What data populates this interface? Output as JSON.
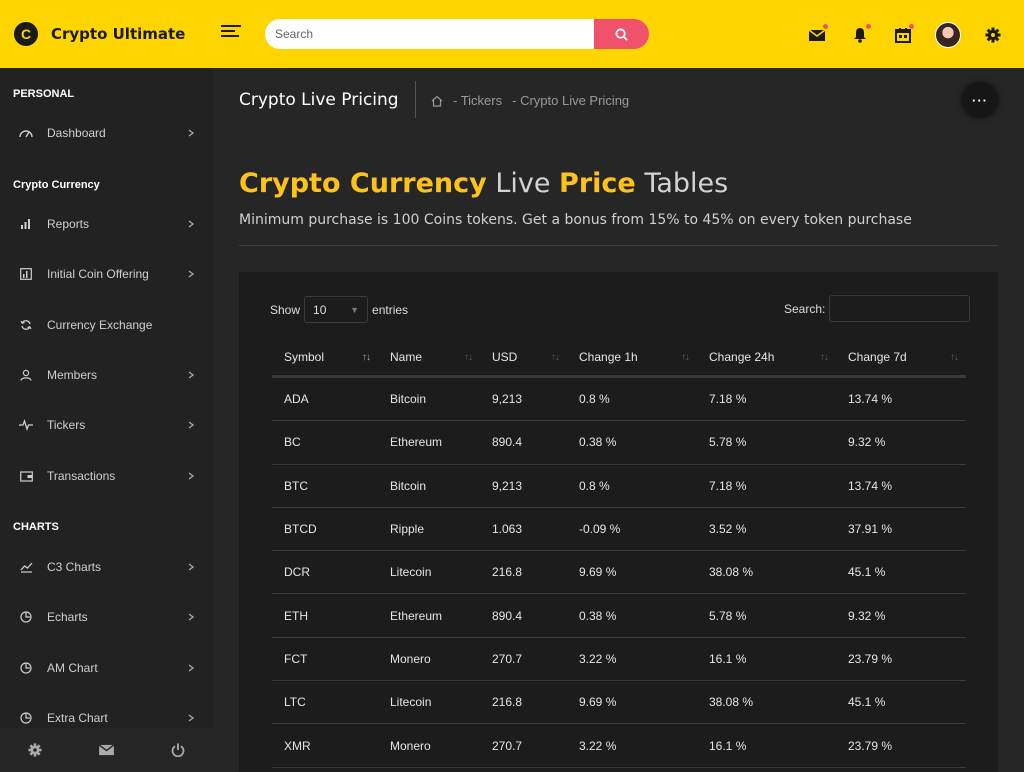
{
  "brand": {
    "name": "Crypto Ultimate",
    "logo_letter": "C"
  },
  "search": {
    "placeholder": "Search"
  },
  "sidebar": {
    "sections": [
      {
        "title": "PERSONAL"
      },
      {
        "title": "Crypto Currency"
      },
      {
        "title": "CHARTS"
      }
    ],
    "items": [
      {
        "label": "Dashboard",
        "icon": "speedometer-icon"
      },
      {
        "label": "Reports",
        "icon": "bar-chart-icon"
      },
      {
        "label": "Initial Coin Offering",
        "icon": "ico-chart-icon"
      },
      {
        "label": "Currency Exchange",
        "icon": "refresh-icon"
      },
      {
        "label": "Members",
        "icon": "user-icon"
      },
      {
        "label": "Tickers",
        "icon": "pulse-icon"
      },
      {
        "label": "Transactions",
        "icon": "wallet-icon"
      },
      {
        "label": "C3 Charts",
        "icon": "line-chart-icon"
      },
      {
        "label": "Echarts",
        "icon": "pie-icon"
      },
      {
        "label": "AM Chart",
        "icon": "pie-icon"
      },
      {
        "label": "Extra Chart",
        "icon": "pie-icon"
      }
    ]
  },
  "page": {
    "title": "Crypto Live Pricing",
    "breadcrumb": [
      "- Tickers",
      "- Crypto Live Pricing"
    ],
    "more_label": "···"
  },
  "hero": {
    "part1": "Crypto Currency",
    "part2": " Live ",
    "part3": "Price",
    "part4": " Tables",
    "subtitle": "Minimum purchase is 100 Coins tokens. Get a bonus from 15% to 45% on every token purchase"
  },
  "table_controls": {
    "show_label": "Show",
    "entries_value": "10",
    "entries_label": "entries",
    "search_label": "Search:"
  },
  "table": {
    "columns": [
      "Symbol",
      "Name",
      "USD",
      "Change 1h",
      "Change 24h",
      "Change 7d"
    ],
    "rows": [
      [
        "ADA",
        "Bitcoin",
        "9,213",
        "0.8 %",
        "7.18 %",
        "13.74 %"
      ],
      [
        "BC",
        "Ethereum",
        "890.4",
        "0.38 %",
        "5.78 %",
        "9.32 %"
      ],
      [
        "BTC",
        "Bitcoin",
        "9,213",
        "0.8 %",
        "7.18 %",
        "13.74 %"
      ],
      [
        "BTCD",
        "Ripple",
        "1.063",
        "-0.09 %",
        "3.52 %",
        "37.91 %"
      ],
      [
        "DCR",
        "Litecoin",
        "216.8",
        "9.69 %",
        "38.08 %",
        "45.1 %"
      ],
      [
        "ETH",
        "Ethereum",
        "890.4",
        "0.38 %",
        "5.78 %",
        "9.32 %"
      ],
      [
        "FCT",
        "Monero",
        "270.7",
        "3.22 %",
        "16.1 %",
        "23.79 %"
      ],
      [
        "LTC",
        "Litecoin",
        "216.8",
        "9.69 %",
        "38.08 %",
        "45.1 %"
      ],
      [
        "XMR",
        "Monero",
        "270.7",
        "3.22 %",
        "16.1 %",
        "23.79 %"
      ]
    ]
  },
  "colors": {
    "header_bg": "#ffd500",
    "accent_yellow": "#ffc21b",
    "accent_red": "#f0526b",
    "sidebar_bg": "#222222"
  }
}
